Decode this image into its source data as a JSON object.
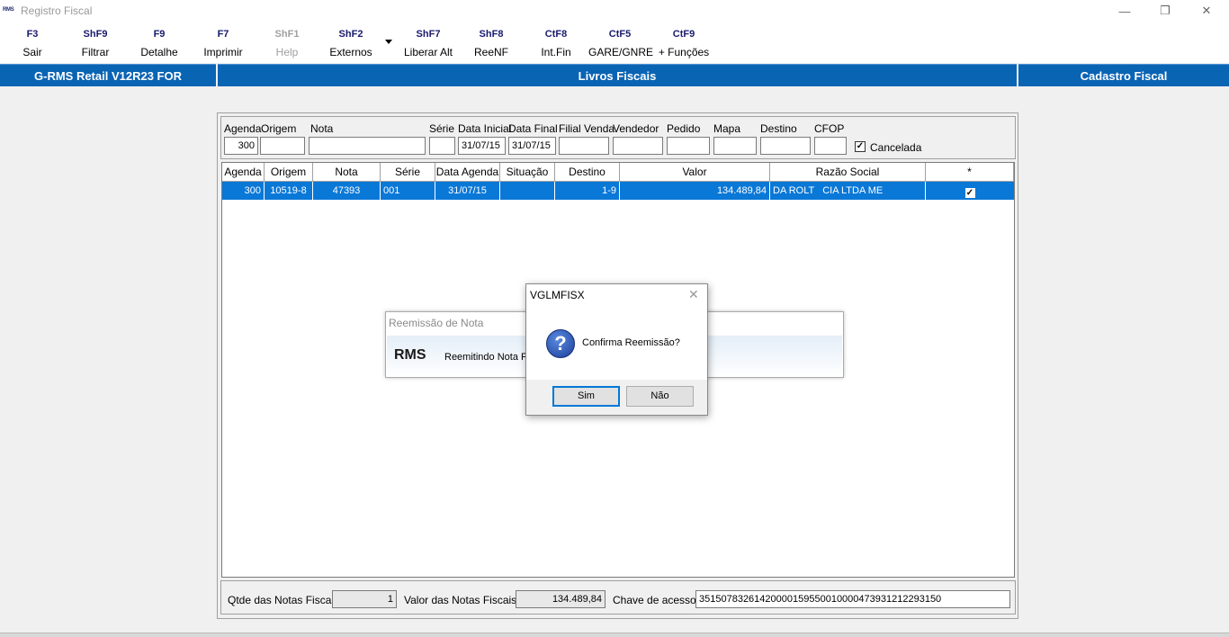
{
  "window": {
    "logo_text": "RMS",
    "title": "Registro Fiscal",
    "minimize_glyph": "—",
    "restore_glyph": "❐",
    "close_glyph": "✕"
  },
  "toolbar": [
    {
      "key": "F3",
      "label": "Sair",
      "enabled": true
    },
    {
      "key": "ShF9",
      "label": "Filtrar",
      "enabled": true
    },
    {
      "key": "F9",
      "label": "Detalhe",
      "enabled": true
    },
    {
      "key": "F7",
      "label": "Imprimir",
      "enabled": true
    },
    {
      "key": "ShF1",
      "label": "Help",
      "enabled": false
    },
    {
      "key": "ShF2",
      "label": "Externos",
      "enabled": true
    },
    {
      "key": "ShF7",
      "label": "Liberar Alt",
      "enabled": true
    },
    {
      "key": "ShF8",
      "label": "ReeNF",
      "enabled": true
    },
    {
      "key": "CtF8",
      "label": "Int.Fin",
      "enabled": true
    },
    {
      "key": "CtF5",
      "label": "GARE/GNRE",
      "enabled": true
    },
    {
      "key": "CtF9",
      "label": "+ Funções",
      "enabled": true
    }
  ],
  "header": {
    "left": "G-RMS Retail V12R23 FOR",
    "center": "Livros Fiscais",
    "right": "Cadastro Fiscal"
  },
  "filters": {
    "agenda": {
      "label": "Agenda",
      "value": "300"
    },
    "origem": {
      "label": "Origem",
      "value": ""
    },
    "nota": {
      "label": "Nota",
      "value": ""
    },
    "serie": {
      "label": "Série",
      "value": ""
    },
    "data_inicial": {
      "label": "Data Inicial",
      "value": "31/07/15"
    },
    "data_final": {
      "label": "Data Final",
      "value": "31/07/15"
    },
    "filial_venda": {
      "label": "Filial Venda",
      "value": ""
    },
    "vendedor": {
      "label": "Vendedor",
      "value": ""
    },
    "pedido": {
      "label": "Pedido",
      "value": ""
    },
    "mapa": {
      "label": "Mapa",
      "value": ""
    },
    "destino": {
      "label": "Destino",
      "value": ""
    },
    "cfop": {
      "label": "CFOP",
      "value": ""
    },
    "cancelada": {
      "label": "Cancelada",
      "checked": true
    }
  },
  "grid": {
    "columns": [
      "Agenda",
      "Origem",
      "Nota",
      "Série",
      "Data Agenda",
      "Situação",
      "Destino",
      "Valor",
      "Razão Social",
      "*"
    ],
    "rows": [
      {
        "agenda": "300",
        "origem": "10519-8",
        "nota": "47393",
        "serie": "001",
        "data_agenda": "31/07/15",
        "situacao": "",
        "destino": "1-9",
        "valor": "134.489,84",
        "razao_social": "DA ROLT   CIA LTDA ME",
        "selected": true
      }
    ]
  },
  "footer": {
    "qtde_label": "Qtde das Notas Fiscais:",
    "qtde_value": "1",
    "valor_label": "Valor  das Notas Fiscais:",
    "valor_value": "134.489,84",
    "chave_label": "Chave de acesso:",
    "chave_value": "35150783261420000159550010000473931212293150"
  },
  "bg_dialog": {
    "title": "Reemissão de Nota",
    "logo": "RMS",
    "text": "Reemitindo Nota Fis"
  },
  "msgbox": {
    "title": "VGLMFISX",
    "icon_glyph": "?",
    "message": "Confirma Reemissão?",
    "yes_label": "Sim",
    "no_label": "Não",
    "close_glyph": "✕"
  }
}
